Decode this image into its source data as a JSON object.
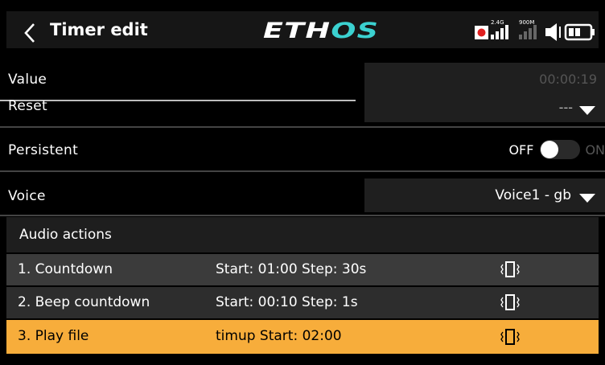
{
  "header": {
    "title": "Timer edit",
    "logo_a": "ETH",
    "logo_b": "OS",
    "signal1_label": "2.4G",
    "signal2_label": "900M"
  },
  "fields": {
    "value": {
      "label": "Value",
      "value": "00:00:19"
    },
    "reset": {
      "label": "Reset",
      "value": "---"
    },
    "persistent": {
      "label": "Persistent",
      "off_label": "OFF",
      "on_label": "ON"
    },
    "voice": {
      "label": "Voice",
      "value": "Voice1 - gb"
    }
  },
  "audio": {
    "header": "Audio actions",
    "rows": [
      {
        "name": "1. Countdown",
        "detail": "Start: 01:00 Step: 30s"
      },
      {
        "name": "2. Beep countdown",
        "detail": "Start: 00:10 Step: 1s"
      },
      {
        "name": "3. Play file",
        "detail": "timup Start: 02:00"
      }
    ]
  },
  "colors": {
    "accent": "#f7ad3b",
    "logo_accent": "#3bd1d0",
    "row_dark": "#2d2d2d",
    "row_mid": "#3b3b3b"
  }
}
